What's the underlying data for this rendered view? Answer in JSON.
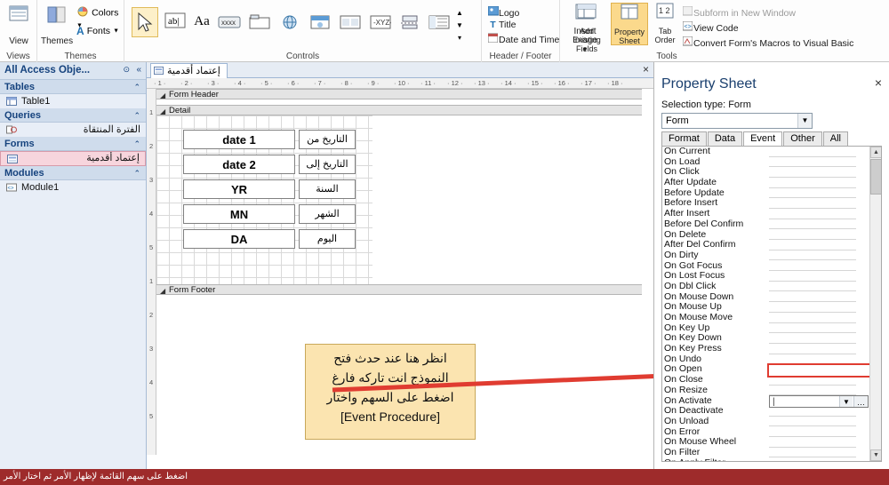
{
  "ribbon": {
    "groups": [
      {
        "label": "Views"
      },
      {
        "label": "Themes"
      },
      {
        "label": "Controls"
      },
      {
        "label": "Header / Footer"
      },
      {
        "label": "Tools"
      }
    ],
    "views": {
      "button_label": "View",
      "icon": "view-icon"
    },
    "themes": {
      "themes_label": "Themes",
      "colors_label": "Colors",
      "fonts_label": "Fonts"
    },
    "controls": {
      "select_icon": "select-arrow-icon",
      "textbox_icon": "textbox-icon",
      "label_icon": "label-icon",
      "button_icon": "button-icon",
      "tab_icon": "tab-control-icon",
      "web_icon": "hyperlink-icon",
      "nav_icon": "navigation-control-icon",
      "image_icon": "image-control-icon",
      "chart_icon": "chart-icon",
      "line_icon": "line-icon",
      "page_break_icon": "page-break-icon",
      "subform_icon": "subform-icon",
      "more_icon": "more-controls-icon",
      "insert_image_label": "Insert Image"
    },
    "header_footer": {
      "logo_label": "Logo",
      "title_label": "Title",
      "date_time_label": "Date and Time"
    },
    "tools": {
      "add_existing_fields_label": "Add Existing Fields",
      "property_sheet_label": "Property Sheet",
      "tab_order_label": "Tab Order",
      "subform_new_window_label": "Subform in New Window",
      "view_code_label": "View Code",
      "convert_macros_label": "Convert Form's Macros to Visual Basic"
    }
  },
  "nav_pane": {
    "title": "All Access Obje...",
    "dropdown_icon": "dropdown-icon",
    "collapse_icon": "double-chevron-left-icon",
    "sections": [
      {
        "label": "Tables",
        "items": [
          {
            "label": "Table1",
            "icon": "table-icon"
          }
        ]
      },
      {
        "label": "Queries",
        "items": [
          {
            "label": "الفترة المنتقاة",
            "icon": "query-icon"
          }
        ]
      },
      {
        "label": "Forms",
        "items": [
          {
            "label": "إعتماد أقدمية",
            "icon": "form-icon",
            "selected": true
          }
        ]
      },
      {
        "label": "Modules",
        "items": [
          {
            "label": "Module1",
            "icon": "module-icon"
          }
        ]
      }
    ]
  },
  "document": {
    "tab_label": "إعتماد أقدمية",
    "tab_icon": "form-icon",
    "close_label": "×",
    "sections": {
      "form_header": "Form Header",
      "detail": "Detail",
      "form_footer": "Form Footer"
    },
    "controls": [
      {
        "value": "date 1",
        "label": "التاريخ من"
      },
      {
        "value": "date 2",
        "label": "التاريخ إلى"
      },
      {
        "value": "YR",
        "label": "السنة"
      },
      {
        "value": "MN",
        "label": "الشهر"
      },
      {
        "value": "DA",
        "label": "اليوم"
      }
    ],
    "callout": {
      "line1": "انظر هنا عند حدث فتح",
      "line2": "النموذج انت تاركه فارغ",
      "line3": "اضغط على السهم واختار",
      "line4": "[Event Procedure]",
      "arrow_color": "#e03c31"
    },
    "ruler_h_ticks": [
      "1",
      "2",
      "3",
      "4",
      "5",
      "6",
      "7",
      "8",
      "9",
      "10",
      "11",
      "12",
      "13",
      "14",
      "15",
      "16",
      "17",
      "18"
    ],
    "ruler_v_ticks": [
      "1",
      "2",
      "3",
      "4",
      "5",
      "1",
      "2",
      "3",
      "4",
      "5"
    ]
  },
  "property_sheet": {
    "title": "Property Sheet",
    "close_label": "×",
    "selection_type_label": "Selection type: Form",
    "selected_object": "Form",
    "tabs": [
      {
        "label": "Format",
        "active": false
      },
      {
        "label": "Data",
        "active": false
      },
      {
        "label": "Event",
        "active": true
      },
      {
        "label": "Other",
        "active": false
      },
      {
        "label": "All",
        "active": false
      }
    ],
    "properties": [
      {
        "name": "On Current",
        "value": ""
      },
      {
        "name": "On Load",
        "value": ""
      },
      {
        "name": "On Click",
        "value": ""
      },
      {
        "name": "After Update",
        "value": ""
      },
      {
        "name": "Before Update",
        "value": ""
      },
      {
        "name": "Before Insert",
        "value": ""
      },
      {
        "name": "After Insert",
        "value": ""
      },
      {
        "name": "Before Del Confirm",
        "value": ""
      },
      {
        "name": "On Delete",
        "value": ""
      },
      {
        "name": "After Del Confirm",
        "value": ""
      },
      {
        "name": "On Dirty",
        "value": ""
      },
      {
        "name": "On Got Focus",
        "value": ""
      },
      {
        "name": "On Lost Focus",
        "value": ""
      },
      {
        "name": "On Dbl Click",
        "value": ""
      },
      {
        "name": "On Mouse Down",
        "value": ""
      },
      {
        "name": "On Mouse Up",
        "value": ""
      },
      {
        "name": "On Mouse Move",
        "value": ""
      },
      {
        "name": "On Key Up",
        "value": ""
      },
      {
        "name": "On Key Down",
        "value": ""
      },
      {
        "name": "On Key Press",
        "value": ""
      },
      {
        "name": "On Undo",
        "value": ""
      },
      {
        "name": "On Open",
        "value": "",
        "highlighted": true
      },
      {
        "name": "On Close",
        "value": ""
      },
      {
        "name": "On Resize",
        "value": ""
      },
      {
        "name": "On Activate",
        "value": "",
        "active": true
      },
      {
        "name": "On Deactivate",
        "value": ""
      },
      {
        "name": "On Unload",
        "value": ""
      },
      {
        "name": "On Error",
        "value": ""
      },
      {
        "name": "On Mouse Wheel",
        "value": ""
      },
      {
        "name": "On Filter",
        "value": ""
      },
      {
        "name": "On Apply Filter",
        "value": ""
      }
    ]
  },
  "status_bar": {
    "text": "اضغط على سهم القائمة لإظهار الأمر ثم اختار الأمر"
  },
  "colors": {
    "accent_red": "#e03c31",
    "status_bar": "#9e2b2b",
    "nav_pane": "#e8eef7",
    "callout_bg": "#fbe4b0",
    "selected_nav": "#f7d5dd"
  }
}
